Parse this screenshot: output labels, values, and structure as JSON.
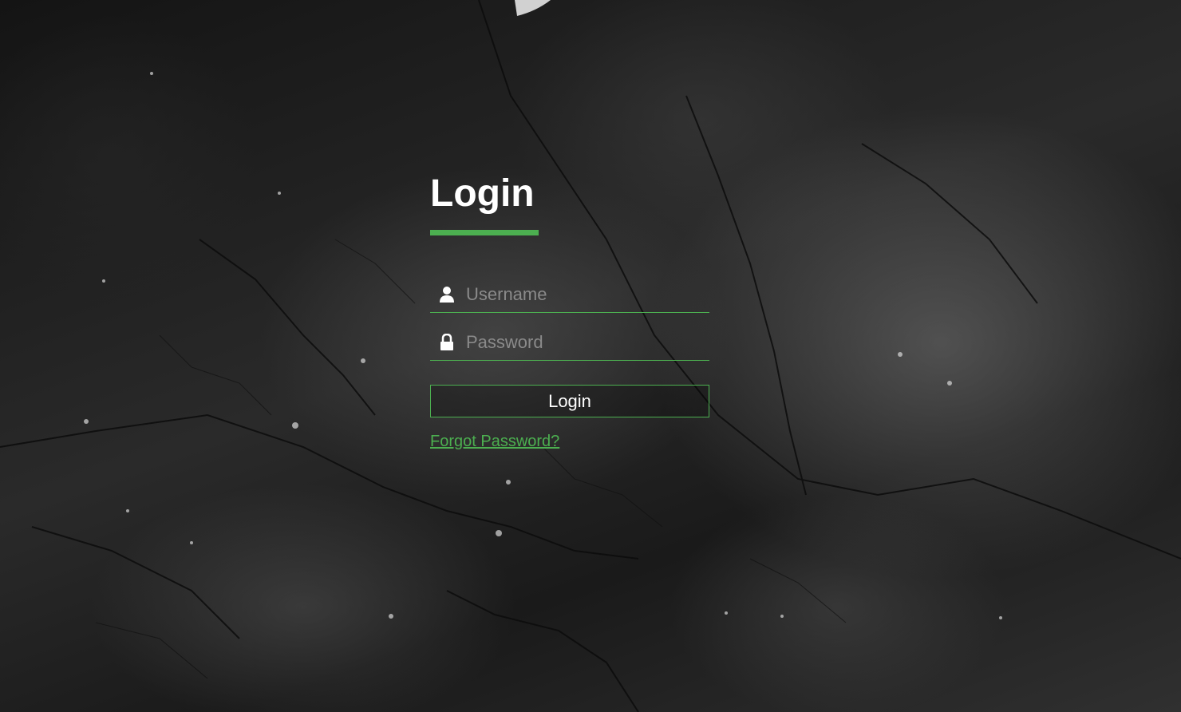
{
  "login": {
    "title": "Login",
    "username": {
      "value": "",
      "placeholder": "Username",
      "icon": "user-icon"
    },
    "password": {
      "value": "",
      "placeholder": "Password",
      "icon": "lock-icon"
    },
    "submit_label": "Login",
    "forgot_password_label": "Forgot Password?"
  },
  "colors": {
    "accent": "#4caf50",
    "text": "#ffffff",
    "placeholder": "#8a8a8a"
  }
}
